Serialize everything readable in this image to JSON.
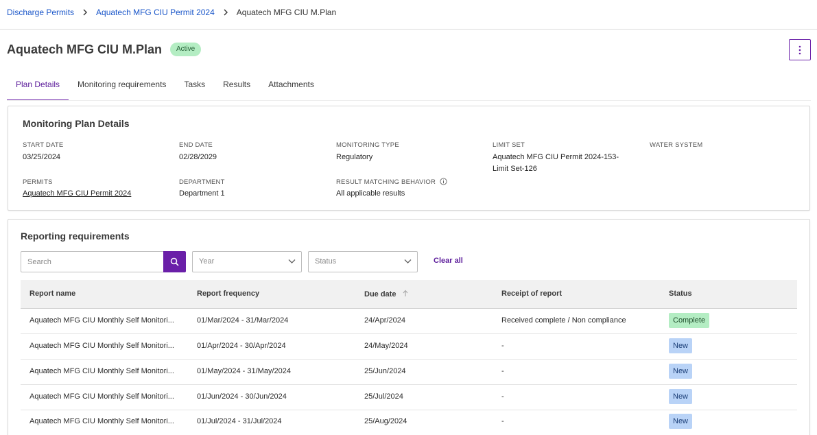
{
  "breadcrumb": {
    "items": [
      "Discharge Permits",
      "Aquatech MFG CIU Permit 2024"
    ],
    "current": "Aquatech MFG CIU M.Plan"
  },
  "header": {
    "title": "Aquatech MFG CIU M.Plan",
    "status": "Active",
    "more_icon": "kebab-vertical-icon"
  },
  "tabs": [
    "Plan Details",
    "Monitoring requirements",
    "Tasks",
    "Results",
    "Attachments"
  ],
  "plan": {
    "title": "Monitoring Plan Details",
    "start_date_label": "START DATE",
    "start_date": "03/25/2024",
    "end_date_label": "END DATE",
    "end_date": "02/28/2029",
    "monitoring_type_label": "MONITORING TYPE",
    "monitoring_type": "Regulatory",
    "limit_set_label": "LIMIT SET",
    "limit_set_line1": "Aquatech MFG CIU Permit 2024-153-",
    "limit_set_line2": "Limit Set-126",
    "water_system_label": "WATER SYSTEM",
    "permits_label": "PERMITS",
    "permits": "Aquatech MFG CIU Permit 2024",
    "department_label": "DEPARTMENT",
    "department": "Department 1",
    "result_matching_label": "RESULT MATCHING BEHAVIOR",
    "result_matching": "All applicable results"
  },
  "reporting": {
    "title": "Reporting requirements",
    "search_placeholder": "Search",
    "year_placeholder": "Year",
    "status_placeholder": "Status",
    "clear_all": "Clear all",
    "columns": [
      "Report name",
      "Report frequency",
      "Due date",
      "Receipt of report",
      "Status"
    ],
    "rows": [
      {
        "name": "Aquatech MFG CIU Monthly Self Monitori...",
        "frequency": "01/Mar/2024 - 31/Mar/2024",
        "due": "24/Apr/2024",
        "receipt": "Received complete / Non compliance",
        "status": "Complete"
      },
      {
        "name": "Aquatech MFG CIU Monthly Self Monitori...",
        "frequency": "01/Apr/2024 - 30/Apr/2024",
        "due": "24/May/2024",
        "receipt": "-",
        "status": "New"
      },
      {
        "name": "Aquatech MFG CIU Monthly Self Monitori...",
        "frequency": "01/May/2024 - 31/May/2024",
        "due": "25/Jun/2024",
        "receipt": "-",
        "status": "New"
      },
      {
        "name": "Aquatech MFG CIU Monthly Self Monitori...",
        "frequency": "01/Jun/2024 - 30/Jun/2024",
        "due": "25/Jul/2024",
        "receipt": "-",
        "status": "New"
      },
      {
        "name": "Aquatech MFG CIU Monthly Self Monitori...",
        "frequency": "01/Jul/2024 - 31/Jul/2024",
        "due": "25/Aug/2024",
        "receipt": "-",
        "status": "New"
      }
    ]
  },
  "colors": {
    "accent": "#6a1fa8",
    "link": "#1a56c9",
    "complete_bg": "#b4edc3",
    "new_bg": "#b9d3f7"
  }
}
